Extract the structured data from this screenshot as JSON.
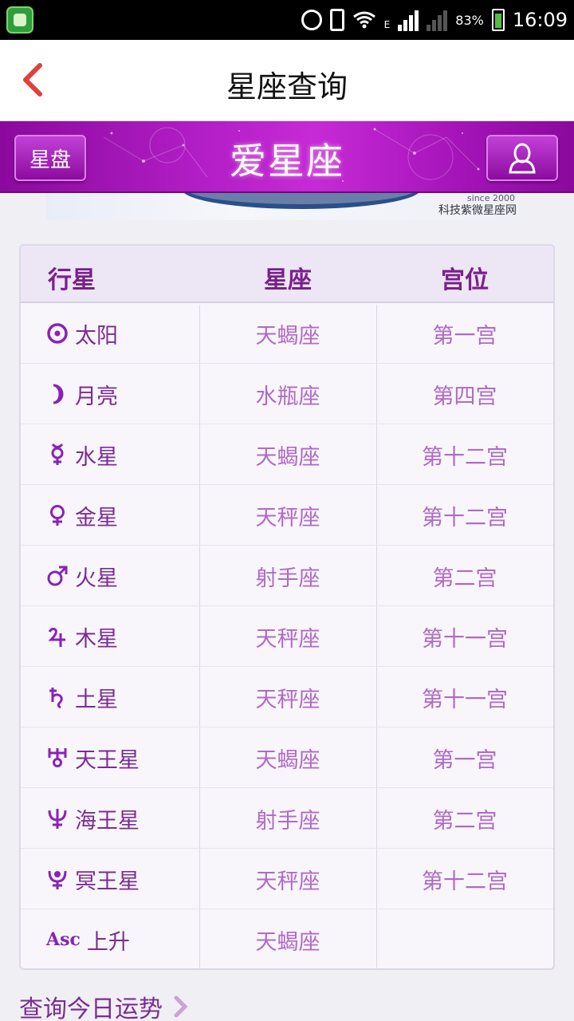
{
  "status_bar": {
    "network": "E",
    "battery": "83%",
    "time": "16:09"
  },
  "header": {
    "title": "星座查询"
  },
  "banner": {
    "left_button": "星盘",
    "brand": "爱星座"
  },
  "ad": {
    "since": "since 2000",
    "text": "科技紫微星座网"
  },
  "table": {
    "headers": [
      "行星",
      "星座",
      "宫位"
    ],
    "rows": [
      {
        "planet": "太阳",
        "sign": "天蝎座",
        "house": "第一宫",
        "icon": "sun-icon"
      },
      {
        "planet": "月亮",
        "sign": "水瓶座",
        "house": "第四宫",
        "icon": "moon-icon"
      },
      {
        "planet": "水星",
        "sign": "天蝎座",
        "house": "第十二宫",
        "icon": "mercury-icon"
      },
      {
        "planet": "金星",
        "sign": "天秤座",
        "house": "第十二宫",
        "icon": "venus-icon"
      },
      {
        "planet": "火星",
        "sign": "射手座",
        "house": "第二宫",
        "icon": "mars-icon"
      },
      {
        "planet": "木星",
        "sign": "天秤座",
        "house": "第十一宫",
        "icon": "jupiter-icon"
      },
      {
        "planet": "土星",
        "sign": "天秤座",
        "house": "第十一宫",
        "icon": "saturn-icon"
      },
      {
        "planet": "天王星",
        "sign": "天蝎座",
        "house": "第一宫",
        "icon": "uranus-icon"
      },
      {
        "planet": "海王星",
        "sign": "射手座",
        "house": "第二宫",
        "icon": "neptune-icon"
      },
      {
        "planet": "冥王星",
        "sign": "天秤座",
        "house": "第十二宫",
        "icon": "pluto-icon"
      },
      {
        "planet": "上升",
        "sign": "天蝎座",
        "house": "",
        "icon": "ascendant-icon",
        "glyph_text": "Asc"
      }
    ]
  },
  "footer": {
    "link": "查询今日运势"
  },
  "colors": {
    "accent": "#a01cb8",
    "planet_text": "#7b2c94",
    "value_text": "#b06ac6",
    "back_arrow": "#e0403c"
  }
}
